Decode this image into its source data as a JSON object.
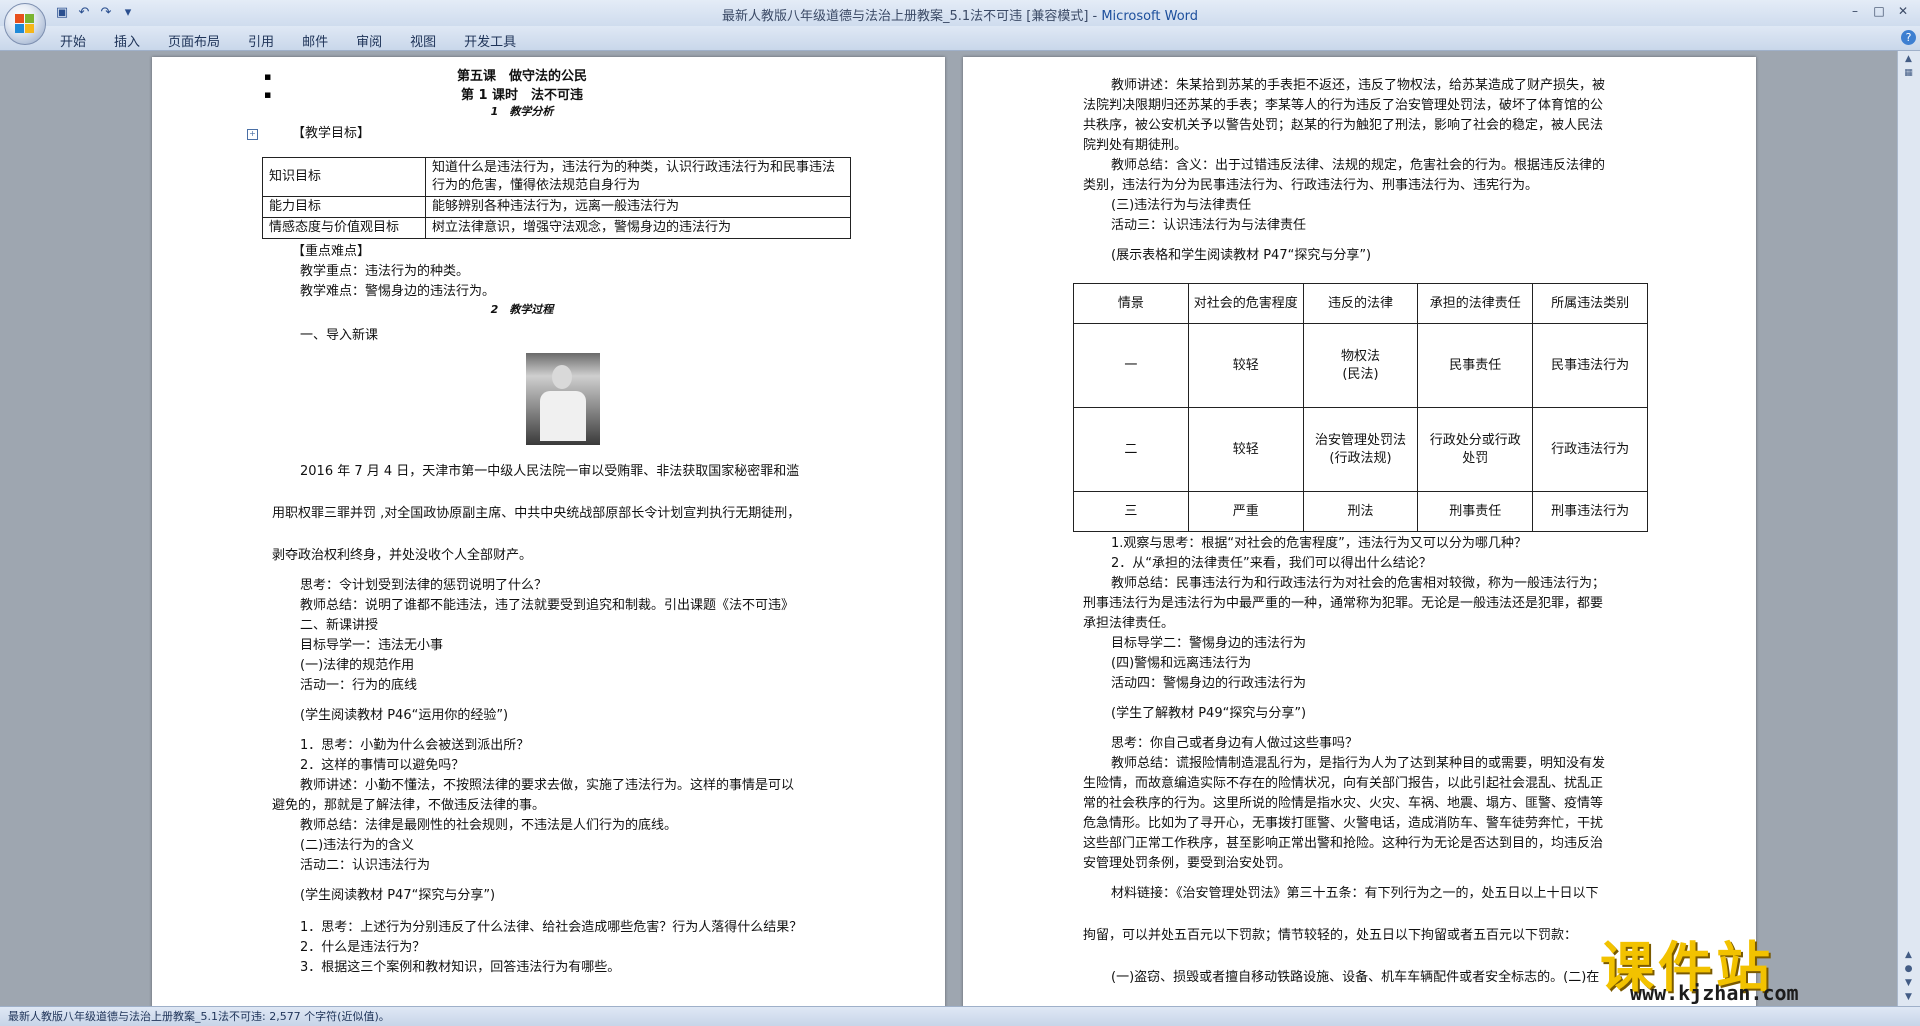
{
  "window": {
    "title_doc": "最新人教版八年级道德与法治上册教案_5.1法不可违 [兼容模式] - ",
    "title_app": "Microsoft Word"
  },
  "menu": [
    "开始",
    "插入",
    "页面布局",
    "引用",
    "邮件",
    "审阅",
    "视图",
    "开发工具"
  ],
  "status": {
    "text": "最新人教版八年级道德与法治上册教案_5.1法不可违: 2,577 个字符(近似值)。"
  },
  "left": {
    "lesson_title": "第五课　做守法的公民",
    "lesson_sub": "第 1 课时　法不可违",
    "section1": "1　教学分析",
    "goals_heading": "【教学目标】",
    "goals_table": [
      [
        "知识目标",
        "知道什么是违法行为，违法行为的种类，认识行政违法行为和民事违法行为的危害，懂得依法规范自身行为"
      ],
      [
        "能力目标",
        "能够辨别各种违法行为，远离一般违法行为"
      ],
      [
        "情感态度与价值观目标",
        "树立法律意识，增强守法观念，警惕身边的违法行为"
      ]
    ],
    "key_heading": "【重点难点】",
    "key_point": "教学重点：违法行为的种类。",
    "difficult_point": "教学难点：警惕身边的违法行为。",
    "section2": "2　教学过程",
    "intro": "一、导入新课",
    "news1": "2016 年 7 月 4 日，天津市第一中级人民法院一审以受贿罪、非法获取国家秘密罪和滥",
    "news2": "用职权罪三罪并罚 ,对全国政协原副主席、中共中央统战部原部长令计划宣判执行无期徒刑，",
    "news3": "剥夺政治权利终身，并处没收个人全部财产。",
    "think1": "思考：令计划受到法律的惩罚说明了什么？",
    "summary1": "教师总结：说明了谁都不能违法，违了法就要受到追究和制裁。引出课题《法不可违》",
    "new_lesson": "二、新课讲授",
    "guide1": "目标导学一：违法无小事",
    "sub1": "(一)法律的规范作用",
    "act1": "活动一：行为的底线",
    "read1": "(学生阅读教材 P46“运用你的经验”)",
    "q1": "1．思考：小勤为什么会被送到派出所？",
    "q2": "2．这样的事情可以避免吗？",
    "explain1a": "教师讲述：小勤不懂法，不按照法律的要求去做，实施了违法行为。这样的事情是可以",
    "explain1b": "避免的，那就是了解法律，不做违反法律的事。",
    "summary2": "教师总结：法律是最刚性的社会规则，不违法是人们行为的底线。",
    "sub2": "(二)违法行为的含义",
    "act2": "活动二：认识违法行为",
    "read2": "(学生阅读教材 P47“探究与分享”)",
    "q3": "1．思考：上述行为分别违反了什么法律、给社会造成哪些危害？行为人落得什么结果？",
    "q4": "2．什么是违法行为？",
    "q5": "3．根据这三个案例和教材知识，回答违法行为有哪些。"
  },
  "right": {
    "p1a": "教师讲述：朱某拾到苏某的手表拒不返还，违反了物权法，给苏某造成了财产损失，被",
    "p1b": "法院判决限期归还苏某的手表；李某等人的行为违反了治安管理处罚法，破坏了体育馆的公",
    "p1c": "共秩序，被公安机关予以警告处罚；赵某的行为触犯了刑法，影响了社会的稳定，被人民法",
    "p1d": "院判处有期徒刑。",
    "p2a": "教师总结：含义：出于过错违反法律、法规的规定，危害社会的行为。根据违反法律的",
    "p2b": "类别，违法行为分为民事违法行为、行政违法行为、刑事违法行为、违宪行为。",
    "sub3": "(三)违法行为与法律责任",
    "act3": "活动三：认识违法行为与法律责任",
    "read3": "(展示表格和学生阅读教材 P47“探究与分享”)",
    "table_header": [
      "情景",
      "对社会的危害程度",
      "违反的法律",
      "承担的法律责任",
      "所属违法类别"
    ],
    "table_rows": [
      [
        "一",
        "较轻",
        "物权法\n(民法)",
        "民事责任",
        "民事违法行为"
      ],
      [
        "二",
        "较轻",
        "治安管理处罚法\n(行政法规)",
        "行政处分或行政\n处罚",
        "行政违法行为"
      ],
      [
        "三",
        "严重",
        "刑法",
        "刑事责任",
        "刑事违法行为"
      ]
    ],
    "q6": "1.观察与思考：根据“对社会的危害程度”，违法行为又可以分为哪几种？",
    "q7": "2．从“承担的法律责任”来看，我们可以得出什么结论？",
    "p3a": "教师总结：民事违法行为和行政违法行为对社会的危害相对较微，称为一般违法行为；",
    "p3b": "刑事违法行为是违法行为中最严重的一种，通常称为犯罪。无论是一般违法还是犯罪，都要",
    "p3c": "承担法律责任。",
    "guide2": "目标导学二：警惕身边的违法行为",
    "sub4": "(四)警惕和远离违法行为",
    "act4": "活动四：警惕身边的行政违法行为",
    "read4": "(学生了解教材 P49“探究与分享”)",
    "think2": "思考：你自己或者身边有人做过这些事吗？",
    "p4a": "教师总结：谎报险情制造混乱行为，是指行为人为了达到某种目的或需要，明知没有发",
    "p4b": "生险情，而故意编造实际不存在的险情状况，向有关部门报告，以此引起社会混乱、扰乱正",
    "p4c": "常的社会秩序的行为。这里所说的险情是指水灾、火灾、车祸、地震、塌方、匪警、疫情等",
    "p4d": "危急情形。比如为了寻开心，无事拨打匪警、火警电话，造成消防车、警车徒劳奔忙，干扰",
    "p4e": "这些部门正常工作秩序，甚至影响正常出警和抢险。这种行为无论是否达到目的，均违反治",
    "p4f": "安管理处罚条例，要受到治安处罚。",
    "law1": "材料链接：《治安管理处罚法》第三十五条：有下列行为之一的，处五日以上十日以下",
    "law2": "拘留，可以并处五百元以下罚款；情节较轻的，处五日以下拘留或者五百元以下罚款：",
    "law3": "(一)盗窃、损毁或者擅自移动铁路设施、设备、机车车辆配件或者安全标志的。(二)在"
  },
  "watermark": {
    "main": "课件站",
    "url": "www.kjzhan.com"
  }
}
